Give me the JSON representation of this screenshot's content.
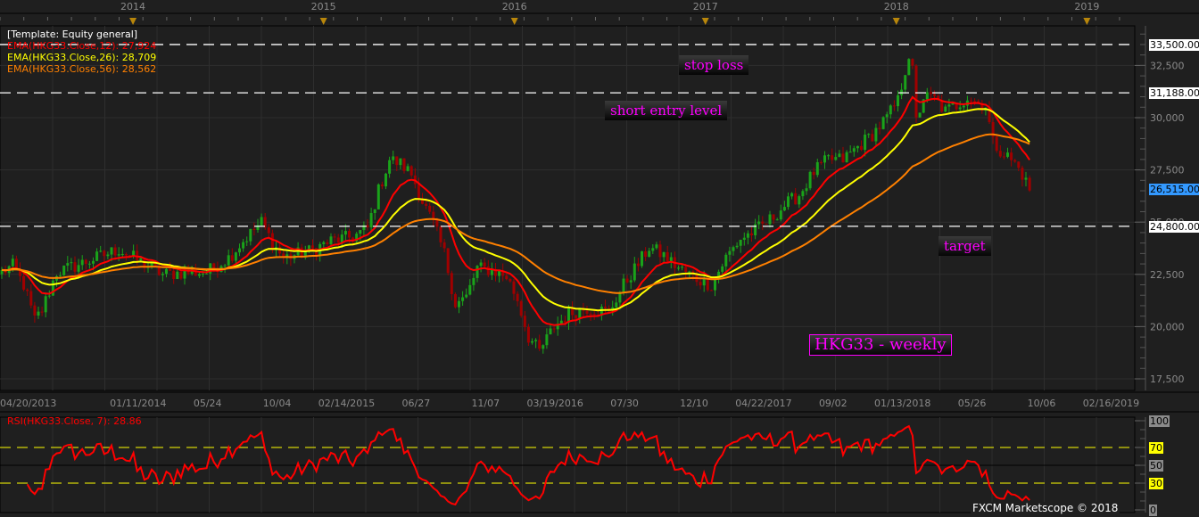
{
  "chart_data": {
    "type": "candlestick",
    "instrument": "HKG33",
    "timeframe": "weekly",
    "template_label": "[Template: Equity general]",
    "indicators": [
      {
        "label": "EMA(HKG33.Close,12): 27,924",
        "period": 12,
        "color": "#ff0000"
      },
      {
        "label": "EMA(HKG33.Close,26): 28,709",
        "period": 26,
        "color": "#ffff00"
      },
      {
        "label": "EMA(HKG33.Close,56): 28,562",
        "period": 56,
        "color": "#ff8000"
      }
    ],
    "rsi": {
      "label": "RSI(HKG33.Close, 7): 28.86",
      "period": 7,
      "color": "#ff0000",
      "levels": [
        {
          "value": 100,
          "label": "100",
          "kind": "gray"
        },
        {
          "value": 70,
          "label": "70",
          "kind": "yellow"
        },
        {
          "value": 50,
          "label": "50",
          "kind": "gray"
        },
        {
          "value": 30,
          "label": "30",
          "kind": "yellow"
        },
        {
          "value": 0,
          "label": "0",
          "kind": "gray"
        }
      ]
    },
    "ylim": [
      17500,
      34500
    ],
    "y_ticks": [
      {
        "value": 17500,
        "label": "17,500"
      },
      {
        "value": 20000,
        "label": "20,000"
      },
      {
        "value": 22500,
        "label": "22,500"
      },
      {
        "value": 25000,
        "label": "25,000"
      },
      {
        "value": 27500,
        "label": "27,500"
      },
      {
        "value": 30000,
        "label": "30,000"
      },
      {
        "value": 32500,
        "label": "32,500"
      }
    ],
    "x_unit": "weeks since 04/20/2013",
    "x_ticks": [
      {
        "week": 0,
        "label": "04/20/2013"
      },
      {
        "week": 38,
        "label": "01/11/2014"
      },
      {
        "week": 57,
        "label": "05/24"
      },
      {
        "week": 76,
        "label": "10/04"
      },
      {
        "week": 95,
        "label": "02/14/2015"
      },
      {
        "week": 114,
        "label": "06/27"
      },
      {
        "week": 133,
        "label": "11/07"
      },
      {
        "week": 152,
        "label": "03/19/2016"
      },
      {
        "week": 171,
        "label": "07/30"
      },
      {
        "week": 190,
        "label": "12/10"
      },
      {
        "week": 209,
        "label": "04/22/2017"
      },
      {
        "week": 228,
        "label": "09/02"
      },
      {
        "week": 247,
        "label": "01/13/2018"
      },
      {
        "week": 266,
        "label": "05/26"
      },
      {
        "week": 285,
        "label": "10/06"
      },
      {
        "week": 304,
        "label": "02/16/2019"
      }
    ],
    "year_markers": [
      {
        "week": 36.6,
        "label": "2014"
      },
      {
        "week": 88.7,
        "label": "2015"
      },
      {
        "week": 140.9,
        "label": "2016"
      },
      {
        "week": 193.1,
        "label": "2017"
      },
      {
        "week": 245.3,
        "label": "2018"
      },
      {
        "week": 297.4,
        "label": "2019"
      }
    ],
    "levels": [
      {
        "value": 33500,
        "label": "33,500.00",
        "note": "stop loss"
      },
      {
        "value": 31188,
        "label": "31,188.00",
        "note": "short entry level"
      },
      {
        "value": 24800,
        "label": "24,800.00",
        "note": "target"
      }
    ],
    "last_price": {
      "value": 26515,
      "label": "26,515.00",
      "color": "#3399ff"
    },
    "weekly_close_keypoints": [
      [
        0,
        22600
      ],
      [
        3,
        22900
      ],
      [
        6,
        22000
      ],
      [
        9,
        20300
      ],
      [
        11,
        20800
      ],
      [
        15,
        22600
      ],
      [
        20,
        22900
      ],
      [
        26,
        23300
      ],
      [
        32,
        23700
      ],
      [
        38,
        23100
      ],
      [
        44,
        22500
      ],
      [
        50,
        22600
      ],
      [
        56,
        22600
      ],
      [
        62,
        23300
      ],
      [
        66,
        24100
      ],
      [
        71,
        25000
      ],
      [
        74,
        24000
      ],
      [
        77,
        23300
      ],
      [
        84,
        23600
      ],
      [
        90,
        24100
      ],
      [
        96,
        24300
      ],
      [
        100,
        24700
      ],
      [
        103,
        26500
      ],
      [
        106,
        28000
      ],
      [
        109,
        27800
      ],
      [
        112,
        27300
      ],
      [
        115,
        26000
      ],
      [
        118,
        24900
      ],
      [
        121,
        23500
      ],
      [
        124,
        21100
      ],
      [
        127,
        21400
      ],
      [
        130,
        22800
      ],
      [
        134,
        22700
      ],
      [
        138,
        22400
      ],
      [
        141,
        21300
      ],
      [
        144,
        19500
      ],
      [
        147,
        18800
      ],
      [
        151,
        20000
      ],
      [
        155,
        20600
      ],
      [
        160,
        20900
      ],
      [
        166,
        20700
      ],
      [
        170,
        22000
      ],
      [
        174,
        23000
      ],
      [
        177,
        23800
      ],
      [
        181,
        23400
      ],
      [
        185,
        22800
      ],
      [
        190,
        22300
      ],
      [
        194,
        22000
      ],
      [
        198,
        23300
      ],
      [
        202,
        24200
      ],
      [
        206,
        24600
      ],
      [
        210,
        25100
      ],
      [
        214,
        25800
      ],
      [
        218,
        26300
      ],
      [
        222,
        27400
      ],
      [
        226,
        28000
      ],
      [
        230,
        28000
      ],
      [
        234,
        28600
      ],
      [
        238,
        29200
      ],
      [
        242,
        30000
      ],
      [
        245,
        30800
      ],
      [
        247,
        32300
      ],
      [
        248,
        33000
      ],
      [
        249,
        32200
      ],
      [
        250,
        29800
      ],
      [
        252,
        31000
      ],
      [
        255,
        30900
      ],
      [
        258,
        30300
      ],
      [
        261,
        30600
      ],
      [
        264,
        31000
      ],
      [
        267,
        30700
      ],
      [
        269,
        30600
      ],
      [
        271,
        28800
      ],
      [
        274,
        28300
      ],
      [
        277,
        27800
      ],
      [
        279,
        27300
      ],
      [
        281,
        26515
      ]
    ],
    "colors": {
      "up": "#1aa31a",
      "down": "#a00000",
      "grid": "#2e2e2e",
      "axis_text": "#8a8a8a",
      "marker": "#b8860b"
    }
  },
  "annotations": {
    "stop_loss": "stop loss",
    "short_entry": "short entry level",
    "target": "target",
    "title": "HKG33 - weekly"
  },
  "footer": {
    "copyright": "FXCM Marketscope © 2018"
  }
}
